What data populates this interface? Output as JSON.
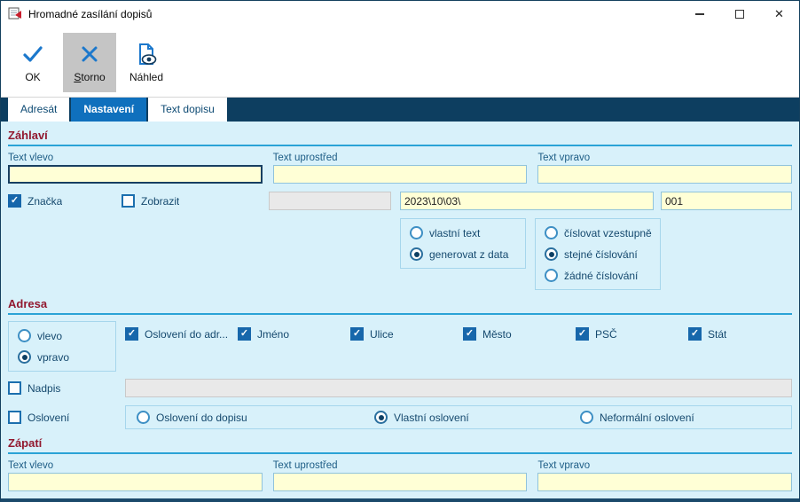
{
  "window": {
    "title": "Hromadné zasílání dopisů"
  },
  "window_controls": {
    "close": "✕"
  },
  "toolbar": {
    "buttons": [
      {
        "label": "OK"
      },
      {
        "label": "Storno",
        "accel": "S",
        "rest": "torno",
        "pressed": true
      },
      {
        "label": "Náhled"
      }
    ]
  },
  "tabs": [
    {
      "label": "Adresát",
      "active": false
    },
    {
      "label": "Nastavení",
      "active": true
    },
    {
      "label": "Text dopisu",
      "active": false
    }
  ],
  "zahlavi": {
    "title": "Záhlaví",
    "fields": [
      {
        "label": "Text vlevo",
        "value": "",
        "focused": true
      },
      {
        "label": "Text uprostřed",
        "value": ""
      },
      {
        "label": "Text vpravo",
        "value": ""
      }
    ],
    "znacka_label": "Značka",
    "znacka_checked": true,
    "zobrazit_label": "Zobrazit",
    "zobrazit_checked": false,
    "mark_value": "",
    "date_value": "2023\\10\\03\\",
    "number_value": "001",
    "text_source_options": [
      {
        "label": "vlastní text",
        "selected": false
      },
      {
        "label": "generovat z data",
        "selected": true
      }
    ],
    "numbering_options": [
      {
        "label": "číslovat vzestupně",
        "selected": false
      },
      {
        "label": "stejné číslování",
        "selected": true
      },
      {
        "label": "žádné číslování",
        "selected": false
      }
    ]
  },
  "adresa": {
    "title": "Adresa",
    "align_options": [
      {
        "label": "vlevo",
        "selected": false
      },
      {
        "label": "vpravo",
        "selected": true
      }
    ],
    "checkboxes": [
      {
        "label": "Oslovení do adr...",
        "checked": true
      },
      {
        "label": "Jméno",
        "checked": true
      },
      {
        "label": "Ulice",
        "checked": true
      },
      {
        "label": "Město",
        "checked": true
      },
      {
        "label": "PSČ",
        "checked": true
      },
      {
        "label": "Stát",
        "checked": true
      }
    ],
    "nadpis_label": "Nadpis",
    "nadpis_checked": false,
    "nadpis_value": "",
    "osloveni_label": "Oslovení",
    "osloveni_checked": false,
    "salutation_options": [
      {
        "label": "Oslovení do dopisu",
        "selected": false
      },
      {
        "label": "Vlastní oslovení",
        "selected": true
      },
      {
        "label": "Neformální oslovení",
        "selected": false
      }
    ]
  },
  "zapati": {
    "title": "Zápatí",
    "fields": [
      {
        "label": "Text vlevo",
        "value": ""
      },
      {
        "label": "Text uprostřed",
        "value": ""
      },
      {
        "label": "Text vpravo",
        "value": ""
      }
    ]
  }
}
